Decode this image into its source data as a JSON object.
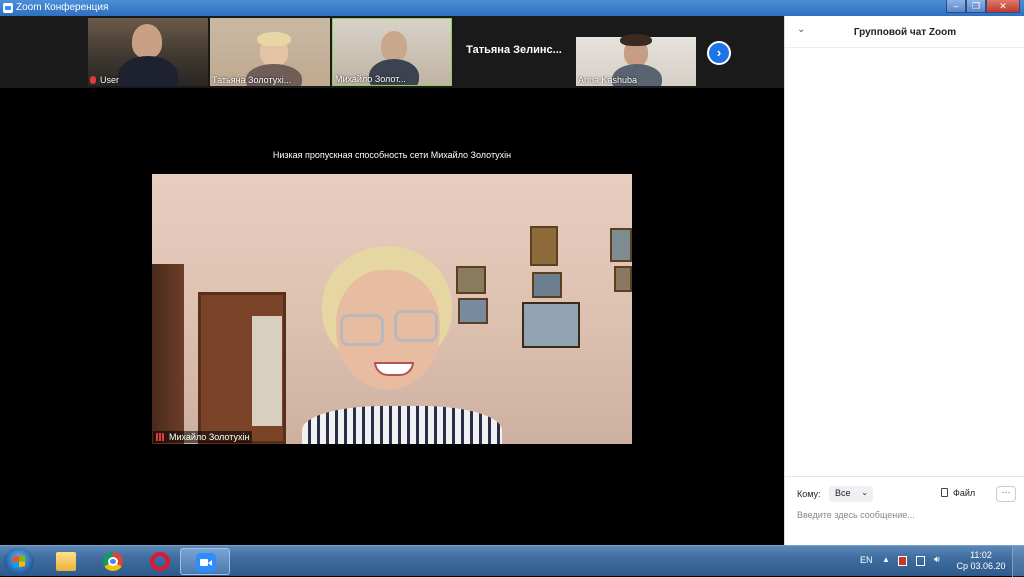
{
  "window": {
    "title": "Zoom Конференция"
  },
  "thumbnails": [
    {
      "name": "User",
      "muted": true
    },
    {
      "name": "Татьяна Золотухі..."
    },
    {
      "name": "Михайло Золот...",
      "active": true
    },
    {
      "name": "Татьяна  Зелинс..."
    },
    {
      "name": "Anna Kashuba"
    }
  ],
  "next_arrow": "›",
  "network_notice": "Низкая пропускная способность сети Михайло Золотухін",
  "active_speaker": {
    "name": "Михайло Золотухін"
  },
  "chat": {
    "title": "Групповой чат Zoom",
    "to_label": "Кому:",
    "to_value": "Все",
    "file_label": "Файл",
    "more_label": "···",
    "input_placeholder": "Введите здесь сообщение..."
  },
  "taskbar": {
    "language": "EN",
    "time": "11:02",
    "date": "Ср 03.06.20"
  }
}
